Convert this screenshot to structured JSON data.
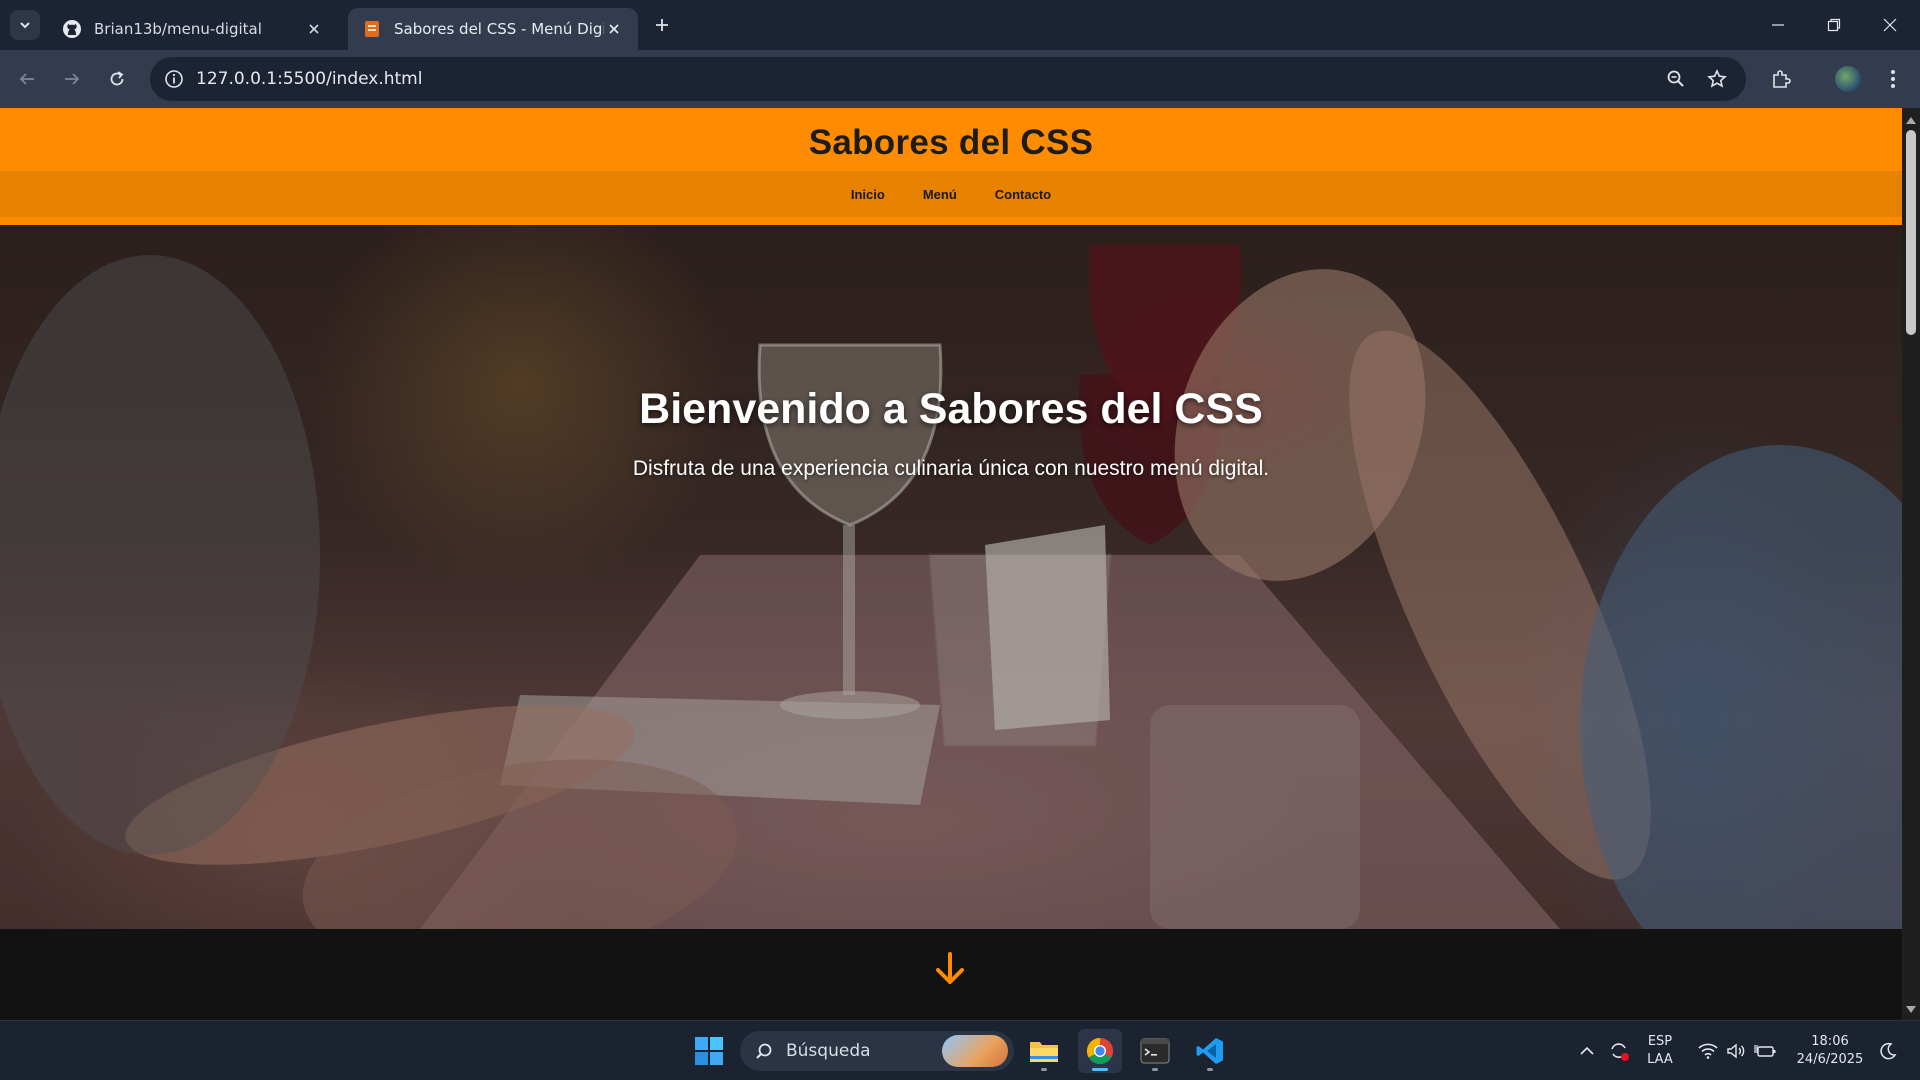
{
  "browser": {
    "tabs": [
      {
        "title": "Brian13b/menu-digital",
        "favicon": "github-icon",
        "active": false
      },
      {
        "title": "Sabores del CSS - Menú Digital",
        "favicon": "html-file-icon",
        "active": true
      }
    ],
    "url": "127.0.0.1:5500/index.html"
  },
  "site": {
    "title": "Sabores del CSS",
    "nav": [
      "Inicio",
      "Menú",
      "Contacto"
    ],
    "hero_title": "Bienvenido a Sabores del CSS",
    "hero_subtitle": "Disfruta de una experiencia culinaria única con nuestro menú digital.",
    "accent_color": "#ff8c00"
  },
  "taskbar": {
    "search_placeholder": "Búsqueda",
    "language": "ESP",
    "layout": "LAA",
    "time": "18:06",
    "date": "24/6/2025"
  }
}
